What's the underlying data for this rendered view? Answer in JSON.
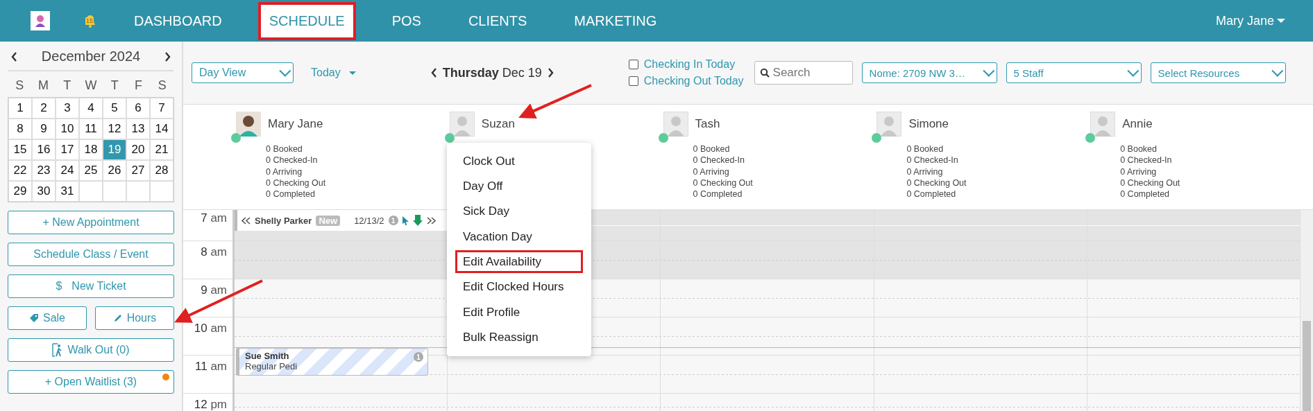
{
  "topbar": {
    "notification_count": "15",
    "tabs": [
      {
        "label": "DASHBOARD",
        "selected": false,
        "highlighted": false
      },
      {
        "label": "SCHEDULE",
        "selected": true,
        "highlighted": true
      },
      {
        "label": "POS",
        "selected": false,
        "highlighted": false
      },
      {
        "label": "CLIENTS",
        "selected": false,
        "highlighted": false
      },
      {
        "label": "MARKETING",
        "selected": false,
        "highlighted": false
      }
    ],
    "user": "Mary Jane"
  },
  "calendar": {
    "month": "December 2024",
    "weekdays": [
      "S",
      "M",
      "T",
      "W",
      "T",
      "F",
      "S"
    ],
    "days": [
      {
        "day": "1",
        "selected": false
      },
      {
        "day": "2",
        "selected": false
      },
      {
        "day": "3",
        "selected": false
      },
      {
        "day": "4",
        "selected": false
      },
      {
        "day": "5",
        "selected": false
      },
      {
        "day": "6",
        "selected": false
      },
      {
        "day": "7",
        "selected": false
      },
      {
        "day": "8",
        "selected": false
      },
      {
        "day": "9",
        "selected": false
      },
      {
        "day": "10",
        "selected": false
      },
      {
        "day": "11",
        "selected": false
      },
      {
        "day": "12",
        "selected": false
      },
      {
        "day": "13",
        "selected": false
      },
      {
        "day": "14",
        "selected": false
      },
      {
        "day": "15",
        "selected": false
      },
      {
        "day": "16",
        "selected": false
      },
      {
        "day": "17",
        "selected": false
      },
      {
        "day": "18",
        "selected": false
      },
      {
        "day": "19",
        "selected": true
      },
      {
        "day": "20",
        "selected": false
      },
      {
        "day": "21",
        "selected": false
      },
      {
        "day": "22",
        "selected": false
      },
      {
        "day": "23",
        "selected": false
      },
      {
        "day": "24",
        "selected": false
      },
      {
        "day": "25",
        "selected": false
      },
      {
        "day": "26",
        "selected": false
      },
      {
        "day": "27",
        "selected": false
      },
      {
        "day": "28",
        "selected": false
      },
      {
        "day": "29",
        "selected": false
      },
      {
        "day": "30",
        "selected": false
      },
      {
        "day": "31",
        "selected": false
      }
    ]
  },
  "sidebar_buttons": [
    [
      {
        "label": "+ New Appointment",
        "kind": "plain"
      }
    ],
    [
      {
        "label": "Schedule Class / Event",
        "kind": "plain"
      }
    ],
    [
      {
        "label": "New Ticket",
        "kind": "dollar",
        "icon_text": "$"
      }
    ],
    [
      {
        "label": "Sale",
        "kind": "tag"
      },
      {
        "label": "Hours",
        "kind": "pencil"
      }
    ],
    [
      {
        "label": "Walk Out (0)",
        "kind": "walk"
      }
    ],
    [
      {
        "label": "+ Open Waitlist (3)",
        "kind": "plain",
        "alert": true
      }
    ]
  ],
  "toolbar": {
    "view": "Day View",
    "today": "Today",
    "weekday": "Thursday",
    "date": "Dec 19",
    "checkboxes": [
      {
        "label": "Checking In Today",
        "checked": false
      },
      {
        "label": "Checking Out Today",
        "checked": false
      }
    ],
    "search": {
      "placeholder": "Search"
    },
    "selects": [
      "Nome: 2709 NW 3…",
      "5 Staff",
      "Select Resources"
    ]
  },
  "staff": [
    {
      "name": "Mary Jane",
      "photo": true,
      "online": true,
      "stats": [
        "0 Booked",
        "0 Checked-In",
        "0 Arriving",
        "0 Checking Out",
        "0 Completed"
      ]
    },
    {
      "name": "Suzan",
      "photo": false,
      "online": true
    },
    {
      "name": "Tash",
      "photo": false,
      "online": true,
      "stats": [
        "0 Booked",
        "0 Checked-In",
        "0 Arriving",
        "0 Checking Out",
        "0 Completed"
      ]
    },
    {
      "name": "Simone",
      "photo": false,
      "online": true,
      "stats": [
        "0 Booked",
        "0 Checked-In",
        "0 Arriving",
        "0 Checking Out",
        "0 Completed"
      ]
    },
    {
      "name": "Annie",
      "photo": false,
      "online": true,
      "stats": [
        "0 Booked",
        "0 Checked-In",
        "0 Arriving",
        "0 Checking Out",
        "0 Completed"
      ]
    }
  ],
  "hours": [
    {
      "label": "7",
      "suffix": "am",
      "shaded": true
    },
    {
      "label": "8",
      "suffix": "am",
      "shaded": true
    },
    {
      "label": "9",
      "suffix": "am",
      "shaded": false
    },
    {
      "label": "10",
      "suffix": "am",
      "shaded": false
    },
    {
      "label": "11",
      "suffix": "am",
      "shaded": false
    },
    {
      "label": "12",
      "suffix": "pm",
      "shaded": false
    }
  ],
  "banner": {
    "client": "Shelly Parker",
    "tag": "New",
    "date": "12/13/2",
    "badge": "1"
  },
  "appointment": {
    "client": "Sue Smith",
    "service": "Regular Pedi",
    "badge": "1"
  },
  "staff_menu": [
    {
      "label": "Clock Out",
      "highlighted": false
    },
    {
      "label": "Day Off",
      "highlighted": false
    },
    {
      "label": "Sick Day",
      "highlighted": false
    },
    {
      "label": "Vacation Day",
      "highlighted": false
    },
    {
      "label": "Edit Availability",
      "highlighted": true
    },
    {
      "label": "Edit Clocked Hours",
      "highlighted": false
    },
    {
      "label": "Edit Profile",
      "highlighted": false
    },
    {
      "label": "Bulk Reassign",
      "highlighted": false
    }
  ]
}
